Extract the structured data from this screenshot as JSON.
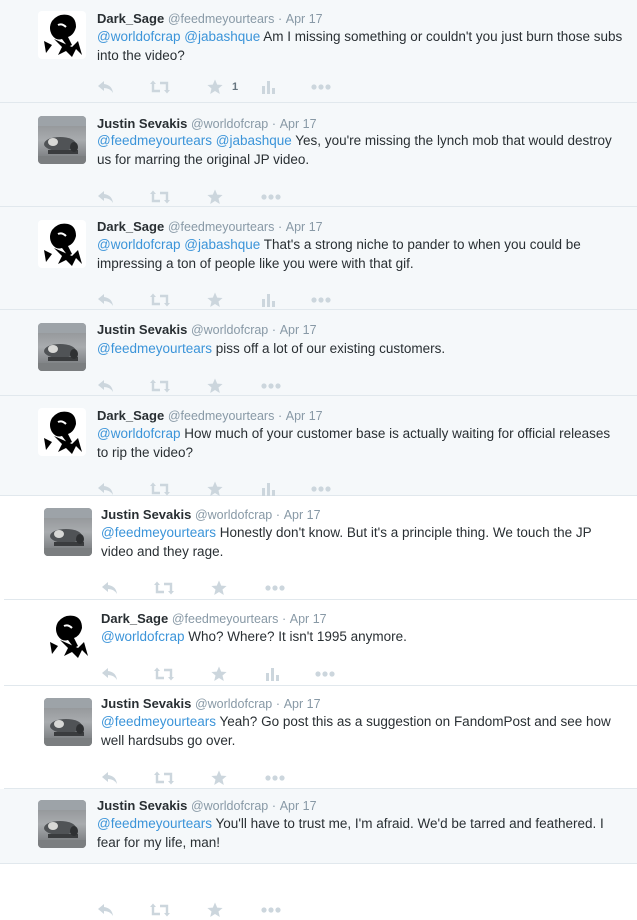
{
  "tweets": [
    {
      "name": "Dark_Sage",
      "handle": "@feedmeyourtears",
      "sep": "·",
      "time": "Apr 17",
      "mentions": "@worldofcrap @jabashque",
      "body": " Am I missing something or couldn't you just burn those subs into the video?",
      "fav_count": "1",
      "avatar": "dark"
    },
    {
      "name": "Justin Sevakis",
      "handle": "@worldofcrap",
      "sep": "·",
      "time": "Apr 17",
      "mentions": "@feedmeyourtears @jabashque",
      "body": " Yes, you're missing the lynch mob that would destroy us for marring the original JP video.",
      "avatar": "photo"
    },
    {
      "name": "Dark_Sage",
      "handle": "@feedmeyourtears",
      "sep": "·",
      "time": "Apr 17",
      "mentions": "@worldofcrap @jabashque",
      "body": " That's a strong niche to pander to when you could be impressing a ton of people like you were with that gif.",
      "avatar": "dark"
    },
    {
      "name": "Justin Sevakis",
      "handle": "@worldofcrap",
      "sep": "·",
      "time": "Apr 17",
      "mentions": "@feedmeyourtears",
      "body": " piss off a lot of our existing customers.",
      "avatar": "photo"
    },
    {
      "name": "Dark_Sage",
      "handle": "@feedmeyourtears",
      "sep": "·",
      "time": "Apr 17",
      "mentions": "@worldofcrap",
      "body": " How much of your customer base is actually waiting for official releases to rip the video?",
      "avatar": "dark"
    },
    {
      "name": "Justin Sevakis",
      "handle": "@worldofcrap",
      "sep": "·",
      "time": "Apr 17",
      "mentions": "@feedmeyourtears",
      "body": " Honestly don't know. But it's a principle thing. We touch the JP video and they rage.",
      "avatar": "photo"
    },
    {
      "name": "Dark_Sage",
      "handle": "@feedmeyourtears",
      "sep": "·",
      "time": "Apr 17",
      "mentions": "@worldofcrap",
      "body": " Who? Where? It isn't 1995 anymore.",
      "avatar": "dark"
    },
    {
      "name": "Justin Sevakis",
      "handle": "@worldofcrap",
      "sep": "·",
      "time": "Apr 17",
      "mentions": "@feedmeyourtears",
      "body": " Yeah? Go post this as a suggestion on FandomPost and see how well hardsubs go over.",
      "avatar": "photo"
    },
    {
      "name": "Justin Sevakis",
      "handle": "@worldofcrap",
      "sep": "·",
      "time": "Apr 17",
      "mentions": "@feedmeyourtears",
      "body": " You'll have to trust me, I'm afraid. We'd be tarred and feathered. I fear for my life, man!",
      "avatar": "photo"
    }
  ],
  "icons": {
    "reply": "reply-icon",
    "retweet": "retweet-icon",
    "favorite": "star-icon",
    "analytics": "bar-chart-icon",
    "more": "more-icon"
  },
  "colors": {
    "link": "#3b94d9",
    "muted": "#8899a6",
    "icon": "#ccd6dd",
    "border": "#e1e8ed",
    "bg_gray": "#f5f8fa"
  }
}
